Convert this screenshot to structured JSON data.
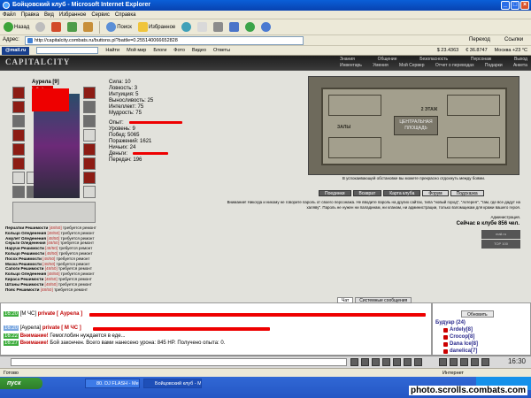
{
  "window": {
    "title": "Бойцовский клуб - Microsoft Internet Explorer"
  },
  "menu": [
    "Файл",
    "Правка",
    "Вид",
    "Избранное",
    "Сервис",
    "Справка"
  ],
  "toolbar": {
    "back": "Назад",
    "search": "Поиск",
    "favorites": "Избранное"
  },
  "address": {
    "label": "Адрес:",
    "url": "http://capitalcity.combats.ru/buttons.pl?battle=0.255140066652828",
    "go": "Переход",
    "links": "Ссылки"
  },
  "linksbar": {
    "mailru": "@mail.ru",
    "search_placeholder": "",
    "find": "Найти",
    "items": [
      "Мой мир",
      "Блоги",
      "Фото",
      "Видео",
      "Ответы"
    ],
    "rates": [
      "$ 23.4363",
      "€ 36.8747"
    ],
    "weather": "Москва +23 °С"
  },
  "game": {
    "logo": "CAPITALCITY",
    "nav_top": [
      "Знания",
      "Общение",
      "Безопасность",
      "Персонаж",
      "Выход"
    ],
    "nav_bottom": [
      "Инвентарь",
      "Умения",
      "Мой Сервер",
      "Отчет о переводах",
      "Подарки",
      "Анкета"
    ],
    "character": {
      "name": "Аурела [9]",
      "hp": "(.../1...)",
      "stats": [
        "Сила: 10",
        "Ловкость: 3",
        "Интуиция: 5",
        "Выносливость: 25",
        "Интеллект: 75",
        "Мудрость: 75"
      ],
      "exp_label": "Опыт:",
      "level": "Уровень: 9",
      "wins": "Побед: 5065",
      "losses": "Поражений: 1621",
      "draws": "Ничьих: 24",
      "money_label": "Деньги:",
      "transfers": "Передач: 196"
    },
    "equipment_status": [
      {
        "item": "Перчатки Решимости",
        "dur": "[48/50]",
        "note": "требуется ремонт"
      },
      {
        "item": "Кольцо Оледенения",
        "dur": "[48/50]",
        "note": "требуется ремонт"
      },
      {
        "item": "Амулет Оледенения",
        "dur": "[48/50]",
        "note": "требуется ремонт"
      },
      {
        "item": "Серьги Оледенения",
        "dur": "[48/50]",
        "note": "требуется ремонт"
      },
      {
        "item": "Наручи Решимости",
        "dur": "[48/50]",
        "note": "требуется ремонт"
      },
      {
        "item": "Кольцо Решимости",
        "dur": "[48/50]",
        "note": "требуется ремонт"
      },
      {
        "item": "Посох Решимости",
        "dur": "[48/50]",
        "note": "требуется ремонт"
      },
      {
        "item": "Маска Решимости",
        "dur": "[48/50]",
        "note": "требуется ремонт"
      },
      {
        "item": "Сапоги Решимости",
        "dur": "[48/50]",
        "note": "требуется ремонт"
      },
      {
        "item": "Кольцо Оледенения",
        "dur": "[48/50]",
        "note": "требуется ремонт"
      },
      {
        "item": "Кираса Решимости",
        "dur": "[48/50]",
        "note": "требуется ремонт"
      },
      {
        "item": "Штаны Решимости",
        "dur": "[48/50]",
        "note": "требуется ремонт"
      },
      {
        "item": "Пояс Решимости",
        "dur": "[48/50]",
        "note": "требуется ремонт"
      }
    ],
    "map": {
      "floor": "2 ЭТАЖ",
      "plaque": "ЦЕНТРАЛЬНАЯ ПЛОЩАДЬ",
      "hall": "ЗАЛЫ",
      "caption": "В успокаивающей обстановке вы можете прекрасно отдохнуть между боями."
    },
    "buttons": [
      "Поединки",
      "Возврат",
      "Карта клубa",
      "Форум",
      "Подсказка"
    ],
    "warning": "Внимание! Никогда и никому не говорите пароль от своего персонажа. Не вводите пароль на других сайтах, типа \"новый город\", \"лотерея\", \"там, где все дадут на халяву\". Пароль не нужен ни паладинам, ни кланам, ни администрации, только взломщикам для кражи вашего героя.",
    "admin": "Администрация.",
    "online": "Сейчас в клубе 856 чел.",
    "counters": [
      "mail.ru",
      "TOP 100"
    ]
  },
  "chat": {
    "tabs": [
      "Чат",
      "Системные сообщения"
    ],
    "lines": [
      {
        "time": "16:20",
        "from": "[М ЧС]",
        "tag": "private [ Аурела ]",
        "text": ""
      },
      {
        "time": "16:20",
        "from": "[Аурела]",
        "tag": "private [ М ЧС ]",
        "text": ""
      },
      {
        "time": "16:22",
        "from": "Внимание!",
        "tag": "",
        "text": "Гемоглобин нуждается в еде..."
      },
      {
        "time": "16:27",
        "from": "Внимание!",
        "tag": "",
        "text": "Бой закончен. Всего вами нанесено урона: 845 HP. Получено опыта: 0."
      }
    ]
  },
  "room": {
    "refresh": "Обновить",
    "name": "Будуар (24)",
    "users": [
      "Ardely[8]",
      "Crocop[8]",
      "Dana Ice[8]",
      "danelica[7]"
    ]
  },
  "clock": "16:30",
  "statusbar": {
    "left": "Готово",
    "right": "Интернет"
  },
  "taskbar": {
    "start": "пуск",
    "tasks": [
      "80. DJ FLASH - Мега...",
      "Бойцовский клуб - M..."
    ],
    "watermark": "photo.scrolls.combats.com"
  }
}
